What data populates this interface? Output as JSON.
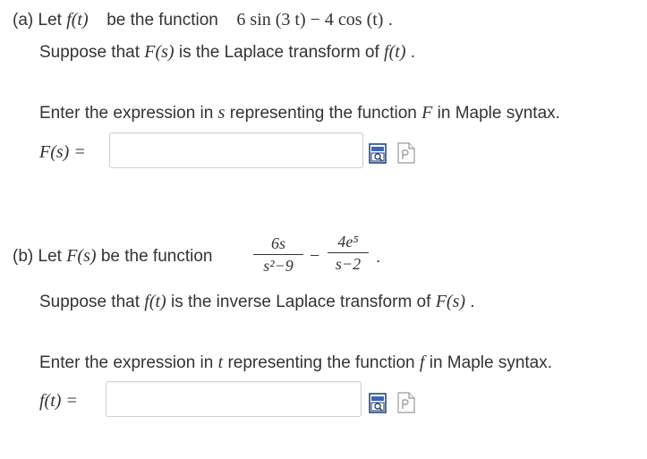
{
  "part_a": {
    "line1_prefix": "(a) Let",
    "f_of_t": "f(t)",
    "line1_mid": "be the function",
    "function_expr": "6 sin (3 t) − 4 cos (t)",
    "period": ".",
    "line2_prefix": "Suppose that",
    "F_of_s": "F(s)",
    "line2_mid": "is the Laplace transform of",
    "f_of_t_2": "f(t)",
    "line3_prefix": "Enter the expression in",
    "var": "s",
    "line3_mid": "representing the function",
    "F": "F",
    "line3_suffix": "in Maple syntax.",
    "answer_label": "F(s) =",
    "answer_value": ""
  },
  "part_b": {
    "line1_prefix": "(b) Let",
    "F_of_s": "F(s)",
    "line1_mid": "be the function",
    "frac1_num": "6s",
    "frac1_den": "s²−9",
    "minus": "−",
    "frac2_num": "4e⁵",
    "frac2_den": "s−2",
    "period": ".",
    "line2_prefix": "Suppose that",
    "f_of_t": "f(t)",
    "line2_mid": "is the inverse Laplace transform of",
    "F_of_s_2": "F(s)",
    "line3_prefix": "Enter the expression in",
    "var": "t",
    "line3_mid": "representing the function",
    "f": "f",
    "line3_suffix": "in Maple syntax.",
    "answer_label": "f(t) =",
    "answer_value": ""
  },
  "icons": {
    "preview": "preview-icon",
    "help": "maple-help-icon"
  }
}
